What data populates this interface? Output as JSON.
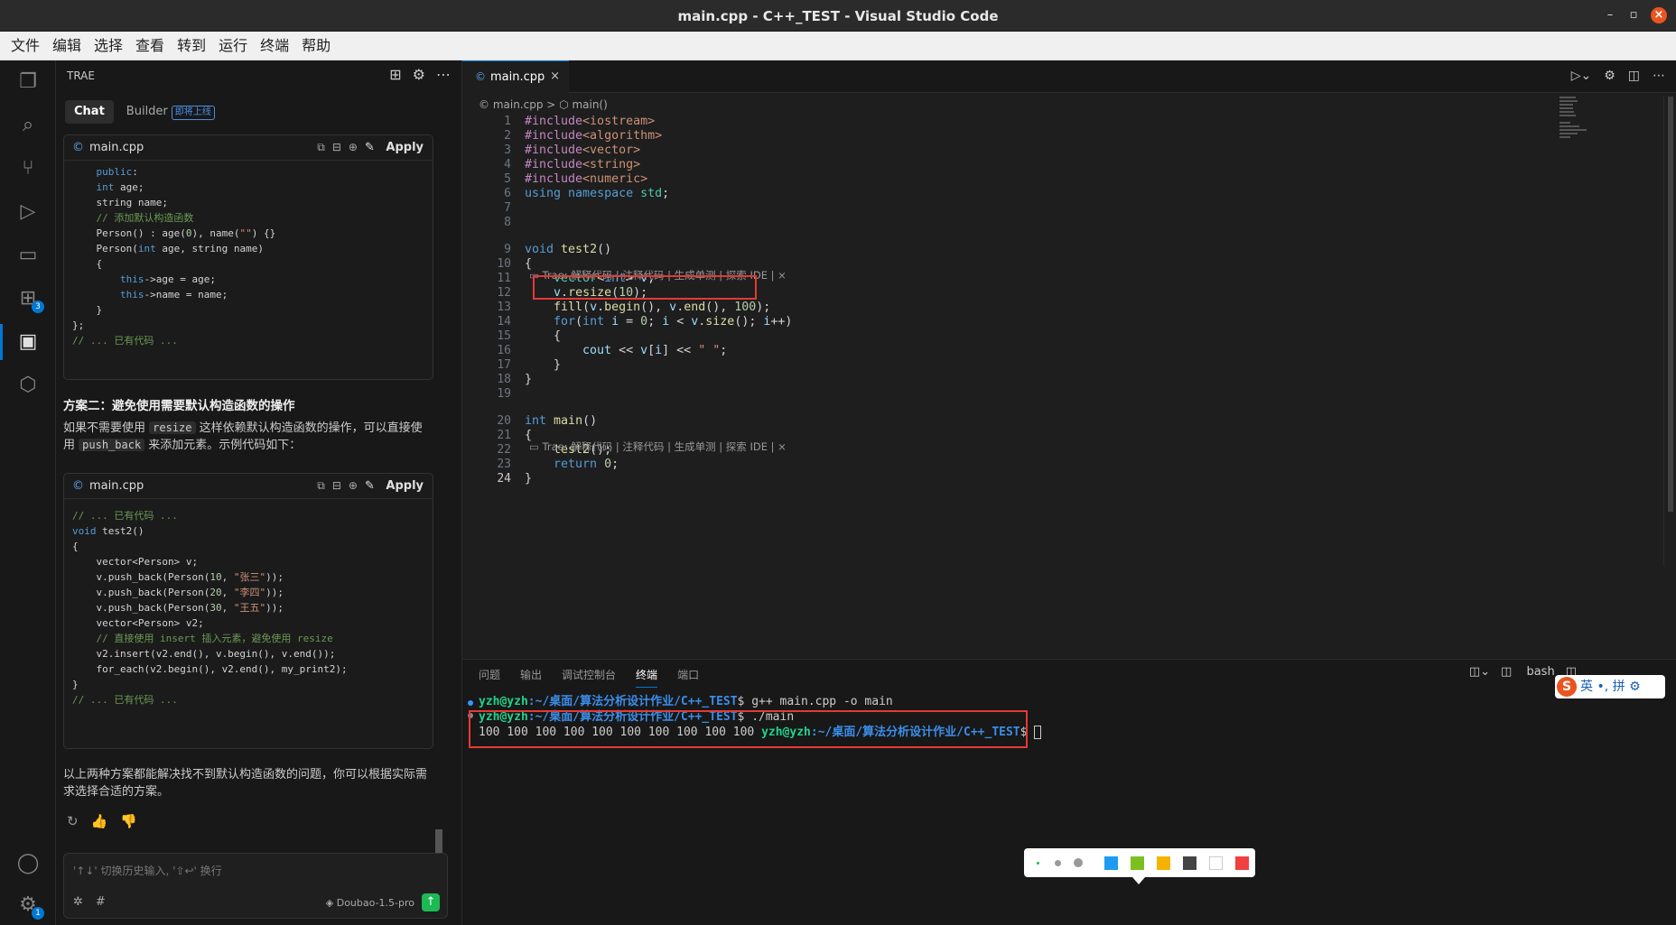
{
  "window": {
    "title": "main.cpp - C++_TEST - Visual Studio Code"
  },
  "menu": [
    "文件",
    "编辑",
    "选择",
    "查看",
    "转到",
    "运行",
    "终端",
    "帮助"
  ],
  "activity": {
    "extensions_badge": "3",
    "settings_badge": "1"
  },
  "sidebar": {
    "header": "TRAE",
    "tabs": {
      "chat": "Chat",
      "builder": "Builder",
      "builder_badge": "即将上线"
    },
    "code1": {
      "file": "main.cpp",
      "apply": "Apply",
      "lines": [
        "    public:",
        "    int age;",
        "    string name;",
        "    // 添加默认构造函数",
        "    Person() : age(0), name(\"\") {}",
        "    Person(int age, string name)",
        "    {",
        "        this->age = age;",
        "        this->name = name;",
        "    }",
        "};",
        "// ... 已有代码 ..."
      ]
    },
    "heading2": "方案二：避免使用需要默认构造函数的操作",
    "para2": {
      "a": "如果不需要使用 ",
      "code1": "resize",
      "b": " 这样依赖默认构造函数的操作，可以直接使",
      "c": "用 ",
      "code2": "push_back",
      "d": " 来添加元素。示例代码如下："
    },
    "code2": {
      "file": "main.cpp",
      "apply": "Apply",
      "lines": [
        "// ... 已有代码 ...",
        "void test2()",
        "{",
        "    vector<Person> v;",
        "    v.push_back(Person(10, \"张三\"));",
        "    v.push_back(Person(20, \"李四\"));",
        "    v.push_back(Person(30, \"王五\"));",
        "    vector<Person> v2;",
        "    // 直接使用 insert 插入元素，避免使用 resize",
        "    v2.insert(v2.end(), v.begin(), v.end());",
        "    for_each(v2.begin(), v2.end(), my_print2);",
        "}",
        "// ... 已有代码 ..."
      ]
    },
    "conclusion1": "以上两种方案都能解决找不到默认构造函数的问题，你可以根据实际需",
    "conclusion2": "求选择合适的方案。",
    "input": {
      "placeholder": "'↑↓' 切换历史输入, '⇧↩' 换行",
      "model": "Doubao-1.5-pro",
      "hash": "#"
    }
  },
  "editor": {
    "tab": "main.cpp",
    "breadcrumb": {
      "file": "main.cpp",
      "symbol": "main()"
    },
    "codelens": "Trae: 解释代码 | 注释代码 | 生成单测 | 探索 IDE | ×",
    "lines": [
      {
        "n": "1",
        "t": "#include<iostream>"
      },
      {
        "n": "2",
        "t": "#include<algorithm>"
      },
      {
        "n": "3",
        "t": "#include<vector>"
      },
      {
        "n": "4",
        "t": "#include<string>"
      },
      {
        "n": "5",
        "t": "#include<numeric>"
      },
      {
        "n": "6",
        "t": "using namespace std;"
      },
      {
        "n": "7",
        "t": ""
      },
      {
        "n": "8",
        "t": ""
      },
      {
        "n": "9",
        "t": "void test2()"
      },
      {
        "n": "10",
        "t": "{"
      },
      {
        "n": "11",
        "t": "    vector<int> v;"
      },
      {
        "n": "12",
        "t": "    v.resize(10);"
      },
      {
        "n": "13",
        "t": "    fill(v.begin(), v.end(), 100);"
      },
      {
        "n": "14",
        "t": "    for(int i = 0; i < v.size(); i++)"
      },
      {
        "n": "15",
        "t": "    {"
      },
      {
        "n": "16",
        "t": "        cout << v[i] << \" \";"
      },
      {
        "n": "17",
        "t": "    }"
      },
      {
        "n": "18",
        "t": "}"
      },
      {
        "n": "19",
        "t": ""
      },
      {
        "n": "20",
        "t": "int main()"
      },
      {
        "n": "21",
        "t": "{"
      },
      {
        "n": "22",
        "t": "    test2();"
      },
      {
        "n": "23",
        "t": "    return 0;"
      },
      {
        "n": "24",
        "t": "}"
      }
    ]
  },
  "panel": {
    "tabs": [
      "问题",
      "输出",
      "调试控制台",
      "终端",
      "端口"
    ],
    "shell": "bash",
    "prompt_user": "yzh@yzh",
    "prompt_path": ":~/桌面/算法分析设计作业/C++_TEST",
    "cmd1": "$ g++ main.cpp -o main",
    "cmd2": "$ ./main",
    "output": "100 100 100 100 100 100 100 100 100 100 ",
    "prompt_end": "$ "
  },
  "ime": {
    "logo": "S",
    "lang": "英",
    "punct": "•,",
    "mode": "拼",
    "gear": "⚙"
  },
  "palette": {
    "colors": [
      "#1e9bf0",
      "#7cc01f",
      "#f5b300",
      "#444444",
      "#ffffff",
      "#f04040"
    ]
  }
}
